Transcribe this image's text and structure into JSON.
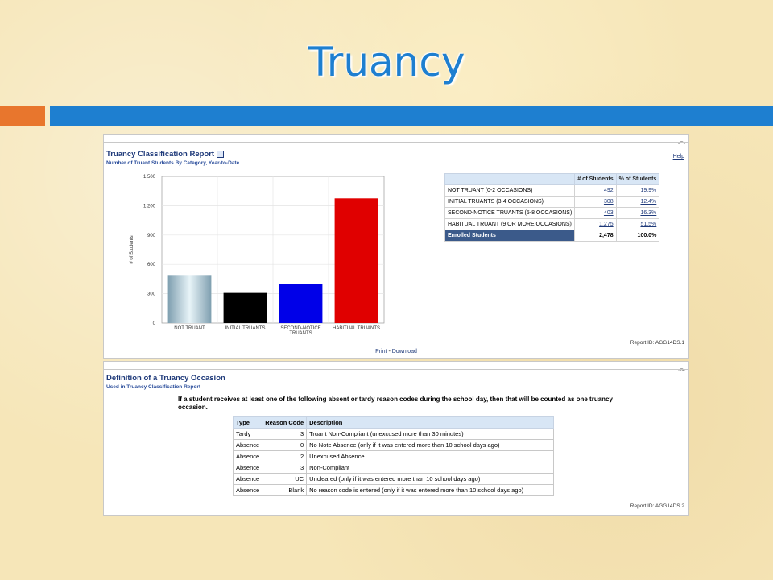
{
  "slide": {
    "title": "Truancy"
  },
  "report1": {
    "title": "Truancy Classification Report",
    "subtitle": "Number of Truant Students By Category, Year-to-Date",
    "help": "Help",
    "report_id": "Report ID: AGG14DS.1",
    "print": "Print",
    "separator": "-",
    "download": "Download",
    "table": {
      "headers": [
        "",
        "# of Students",
        "% of Students"
      ],
      "rows": [
        {
          "label": "NOT TRUANT (0-2 OCCASIONS)",
          "count": "492",
          "pct": "19.9%"
        },
        {
          "label": "INITIAL TRUANTS (3-4 OCCASIONS)",
          "count": "308",
          "pct": "12.4%"
        },
        {
          "label": "SECOND-NOTICE TRUANTS (5-8 OCCASIONS)",
          "count": "403",
          "pct": "16.3%"
        },
        {
          "label": "HABITUAL TRUANT (9 OR MORE OCCASIONS)",
          "count": "1,275",
          "pct": "51.5%"
        }
      ],
      "total": {
        "label": "Enrolled Students",
        "count": "2,478",
        "pct": "100.0%"
      }
    }
  },
  "chart_data": {
    "type": "bar",
    "categories": [
      "NOT TRUANT",
      "INITIAL TRUANTS",
      "SECOND-NOTICE TRUANTS",
      "HABITUAL TRUANTS"
    ],
    "values": [
      492,
      308,
      403,
      1275
    ],
    "colors": [
      "#b8d4e0",
      "#000000",
      "#0000e8",
      "#e00000"
    ],
    "ylabel": "# of Students",
    "yticks": [
      "0",
      "300",
      "600",
      "900",
      "1,200",
      "1,500"
    ],
    "ylim": [
      0,
      1500
    ],
    "grid": true
  },
  "report2": {
    "title": "Definition of a Truancy Occasion",
    "subtitle": "Used in Truancy Classification Report",
    "intro": "If a student receives at least one of the following absent or tardy reason codes during the school day, then that will be counted as one truancy occasion.",
    "report_id": "Report ID: AGG14DS.2",
    "headers": [
      "Type",
      "Reason Code",
      "Description"
    ],
    "rows": [
      {
        "type": "Tardy",
        "code": "3",
        "desc": "Truant Non-Compliant (unexcused more than 30 minutes)"
      },
      {
        "type": "Absence",
        "code": "0",
        "desc": "No Note Absence (only if it was entered more than 10 school days ago)"
      },
      {
        "type": "Absence",
        "code": "2",
        "desc": "Unexcused Absence"
      },
      {
        "type": "Absence",
        "code": "3",
        "desc": "Non-Compliant"
      },
      {
        "type": "Absence",
        "code": "UC",
        "desc": "Uncleared (only if it was entered more than 10 school days ago)"
      },
      {
        "type": "Absence",
        "code": "Blank",
        "desc": "No reason code is entered (only if it was entered more than 10 school days ago)"
      }
    ]
  },
  "icons": {
    "collapse": "collapse-up-icon",
    "report": "report-icon"
  }
}
